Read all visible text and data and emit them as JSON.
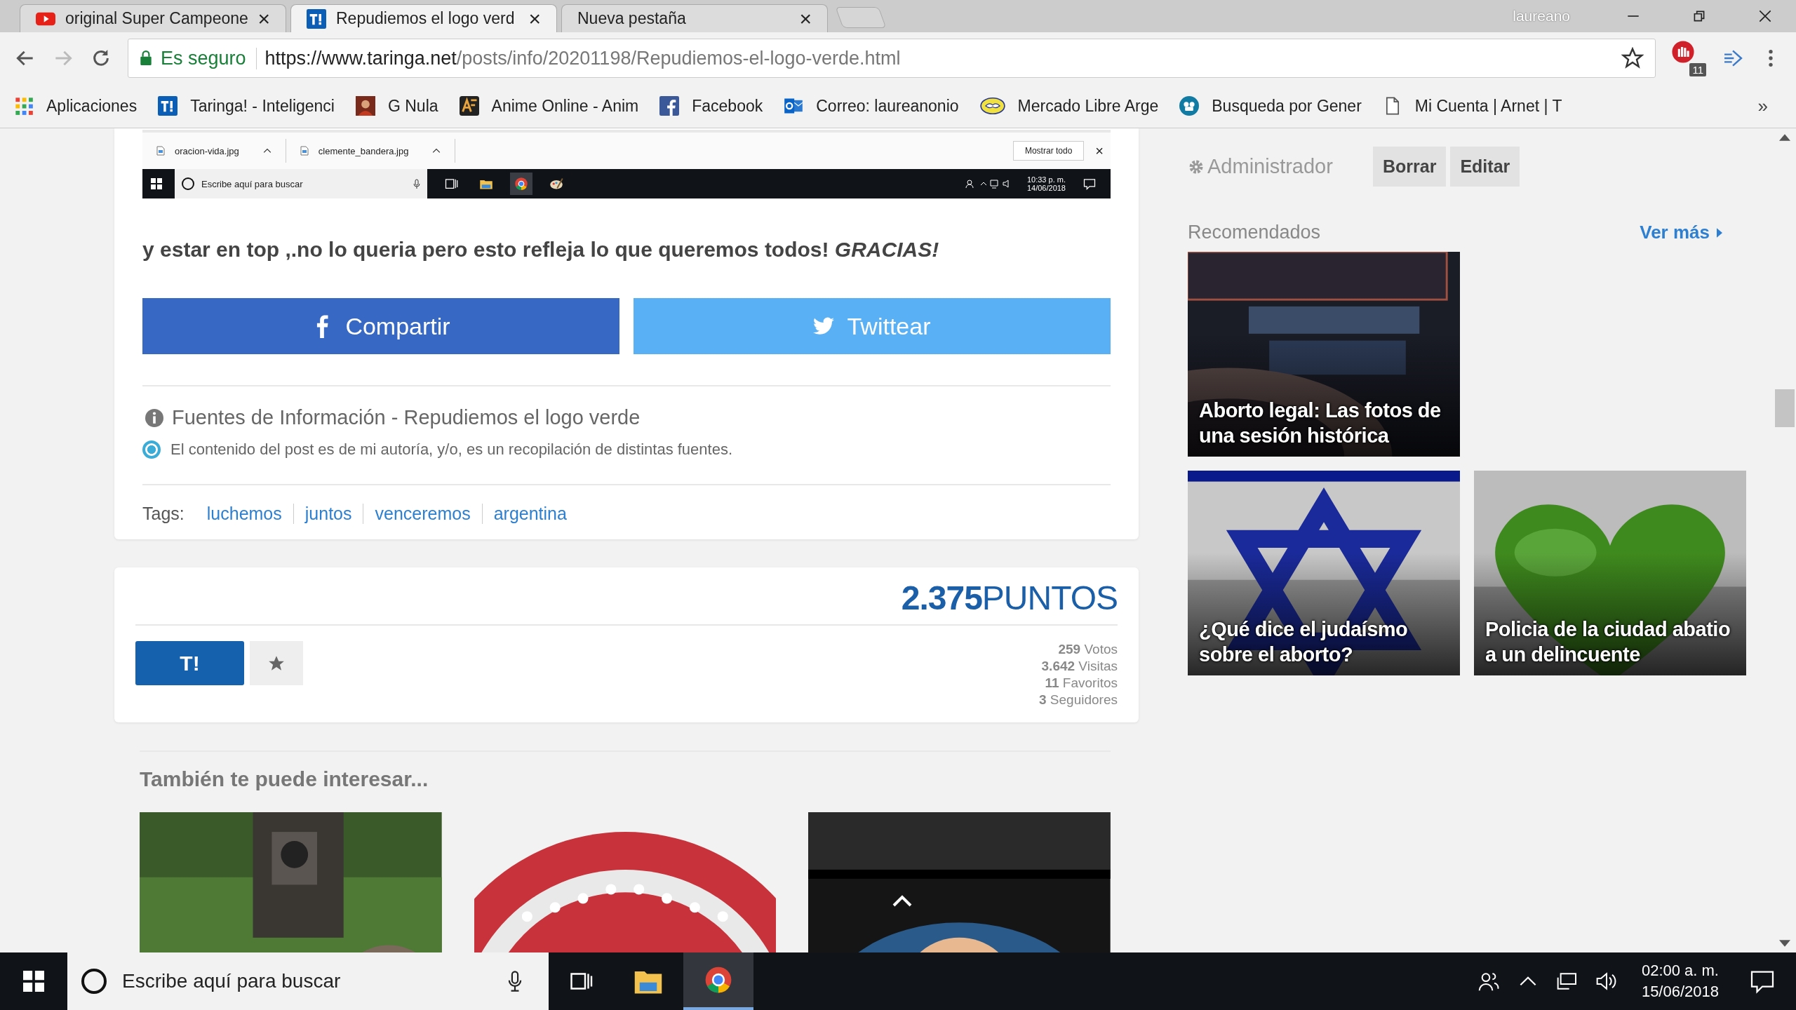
{
  "browser": {
    "tabs": [
      {
        "title": "original Super Campeone",
        "selected": false
      },
      {
        "title": "Repudiemos el logo verd",
        "selected": true
      },
      {
        "title": "Nueva pestaña",
        "selected": false
      }
    ],
    "close_glyph": "×",
    "user": "laureano",
    "security": "Es seguro",
    "url_host": "https://www.taringa.net",
    "url_path": "/posts/info/20201198/Repudiemos-el-logo-verde.html",
    "extension_badge": "11",
    "bookmarks": [
      {
        "label": "Aplicaciones"
      },
      {
        "label": "Taringa! - Inteligenci"
      },
      {
        "label": "G Nula"
      },
      {
        "label": "Anime Online - Anim"
      },
      {
        "label": "Facebook"
      },
      {
        "label": "Correo: laureanonio"
      },
      {
        "label": "Mercado Libre Arge"
      },
      {
        "label": "Busqueda por Gener"
      },
      {
        "label": "Mi Cuenta | Arnet | T"
      }
    ],
    "more_bookmarks": "»"
  },
  "embedded_screenshot": {
    "downloads": [
      "oracion-vida.jpg",
      "clemente_bandera.jpg"
    ],
    "show_all": "Mostrar todo",
    "close": "×",
    "search": "Escribe aquí para buscar",
    "time": "10:33 p. m.",
    "date": "14/06/2018"
  },
  "post": {
    "text": "y estar en top ,.no lo queria pero esto refleja lo que queremos todos! *GRACIAS!*",
    "share": [
      {
        "label": "Compartir",
        "kind": "facebook"
      },
      {
        "label": "Twittear",
        "kind": "twitter"
      }
    ],
    "sources_title": "Fuentes de Información - Repudiemos el logo verde",
    "source_note": "El contenido del post es de mi autoría, y/o, es un recopilación de distintas fuentes.",
    "source_selected": true,
    "tags_label": "Tags:",
    "tags": [
      "luchemos",
      "juntos",
      "venceremos",
      "argentina"
    ]
  },
  "points": {
    "value": "2.375",
    "unit": "PUNTOS",
    "button": "T!",
    "stats": [
      "**259** Votos",
      "**3.642** Visitas",
      "**11** Favoritos",
      "**3** Seguidores"
    ]
  },
  "related": {
    "title": "También te puede interesar..."
  },
  "sidebar": {
    "admin": "Administrador",
    "buttons": [
      "Borrar",
      "Editar"
    ],
    "recommended_title": "Recomendados",
    "see_more": "Ver más",
    "cards": [
      {
        "title": "Aborto legal: Las fotos de una sesión histórica"
      },
      {
        "title": "¿Qué dice el judaísmo sobre el aborto?"
      },
      {
        "title": "Policia de la ciudad abatio a un delincuente"
      }
    ]
  },
  "taskbar": {
    "search_placeholder": "Escribe aquí para buscar",
    "time": "02:00 a. m.",
    "date": "15/06/2018"
  }
}
